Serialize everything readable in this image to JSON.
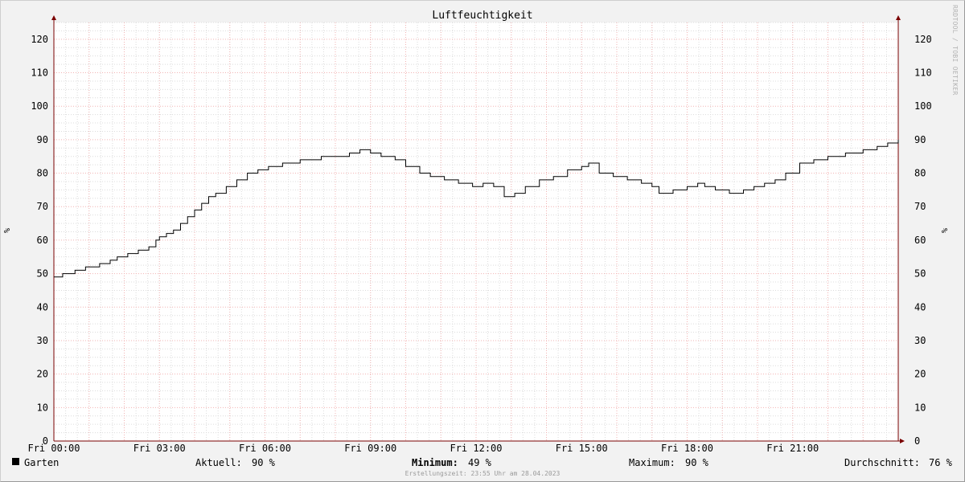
{
  "chart_data": {
    "type": "line",
    "title": "Luftfeuchtigkeit",
    "ylabel_left": "%",
    "ylabel_right": "%",
    "ylim": [
      0,
      125
    ],
    "y_ticks": [
      0,
      10,
      20,
      30,
      40,
      50,
      60,
      70,
      80,
      90,
      100,
      110,
      120
    ],
    "xlim": [
      0,
      24
    ],
    "x_ticks": [
      {
        "x": 0,
        "label": "Fri 00:00"
      },
      {
        "x": 3,
        "label": "Fri 03:00"
      },
      {
        "x": 6,
        "label": "Fri 06:00"
      },
      {
        "x": 9,
        "label": "Fri 09:00"
      },
      {
        "x": 12,
        "label": "Fri 12:00"
      },
      {
        "x": 15,
        "label": "Fri 15:00"
      },
      {
        "x": 18,
        "label": "Fri 18:00"
      },
      {
        "x": 21,
        "label": "Fri 21:00"
      }
    ],
    "grid": true,
    "series": [
      {
        "name": "Garten",
        "color": "#000000",
        "x": [
          0,
          0.25,
          0.6,
          0.9,
          1.3,
          1.6,
          1.8,
          2.1,
          2.4,
          2.7,
          2.9,
          3.0,
          3.2,
          3.4,
          3.6,
          3.8,
          4.0,
          4.2,
          4.4,
          4.6,
          4.9,
          5.2,
          5.5,
          5.8,
          6.1,
          6.5,
          7.0,
          7.6,
          8.4,
          8.7,
          9.0,
          9.3,
          9.7,
          10.0,
          10.4,
          10.7,
          11.1,
          11.5,
          11.9,
          12.2,
          12.5,
          12.8,
          13.1,
          13.4,
          13.8,
          14.2,
          14.6,
          15.0,
          15.2,
          15.5,
          15.9,
          16.3,
          16.7,
          17.0,
          17.2,
          17.6,
          18.0,
          18.3,
          18.5,
          18.8,
          19.0,
          19.2,
          19.6,
          19.9,
          20.2,
          20.5,
          20.8,
          21.2,
          21.6,
          22.0,
          22.5,
          23.0,
          23.4,
          23.7,
          24.0
        ],
        "values": [
          49,
          50,
          51,
          52,
          53,
          54,
          55,
          56,
          57,
          58,
          60,
          61,
          62,
          63,
          65,
          67,
          69,
          71,
          73,
          74,
          76,
          78,
          80,
          81,
          82,
          83,
          84,
          85,
          86,
          87,
          86,
          85,
          84,
          82,
          80,
          79,
          78,
          77,
          76,
          77,
          76,
          73,
          74,
          76,
          78,
          79,
          81,
          82,
          83,
          80,
          79,
          78,
          77,
          76,
          74,
          75,
          76,
          77,
          76,
          75,
          75,
          74,
          75,
          76,
          77,
          78,
          80,
          83,
          84,
          85,
          86,
          87,
          88,
          89,
          90
        ]
      }
    ],
    "legend": {
      "label": "Garten",
      "current_label": "Aktuell:",
      "current_value": "90 %",
      "min_label": "Minimum:",
      "min_value": "49 %",
      "max_label": "Maximum:",
      "max_value": "90 %",
      "avg_label": "Durchschnitt:",
      "avg_value": "76 %"
    },
    "footer": "Erstellungszeit: 23:55 Uhr am 28.04.2023",
    "watermark": "RRDTOOL / TOBI OETIKER",
    "colors": {
      "background": "#f2f2f2",
      "canvas": "#ffffff",
      "minor_grid": "#dcdcdc",
      "major_grid": "#f2b3b3",
      "axis": "#7a0000",
      "line": "#000000"
    }
  }
}
